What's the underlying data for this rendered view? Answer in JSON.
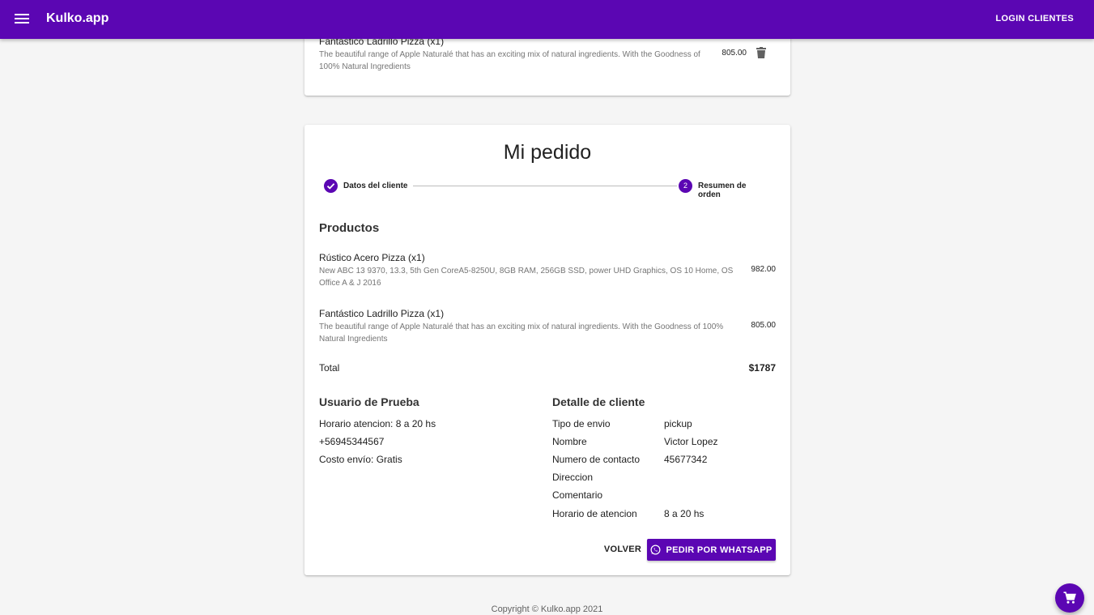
{
  "appbar": {
    "brand": "Kulko.app",
    "login_label": "LOGIN CLIENTES"
  },
  "cart_preview": {
    "item": {
      "name": "Fantástico Ladrillo Pizza (x1)",
      "description": "The beautiful range of Apple Naturalé that has an exciting mix of natural ingredients. With the Goodness of 100% Natural Ingredients",
      "price": "805.00"
    }
  },
  "order": {
    "title": "Mi pedido",
    "steps": [
      {
        "label": "Datos del cliente",
        "state": "done"
      },
      {
        "number": "2",
        "label": "Resumen de orden",
        "state": "active"
      }
    ],
    "products_heading": "Productos",
    "products": [
      {
        "name": "Rústico Acero Pizza (x1)",
        "description": "New ABC 13 9370, 13.3, 5th Gen CoreA5-8250U, 8GB RAM, 256GB SSD, power UHD Graphics, OS 10 Home, OS Office A & J 2016",
        "price": "982.00"
      },
      {
        "name": "Fantástico Ladrillo Pizza (x1)",
        "description": "The beautiful range of Apple Naturalé that has an exciting mix of natural ingredients. With the Goodness of 100% Natural Ingredients",
        "price": "805.00"
      }
    ],
    "total_label": "Total",
    "total_value": "$1787",
    "store": {
      "heading": "Usuario de Prueba",
      "lines": [
        "Horario atencion: 8 a 20 hs",
        "+56945344567",
        "Costo envío: Gratis"
      ]
    },
    "client": {
      "heading": "Detalle de cliente",
      "rows": [
        {
          "label": "Tipo de envio",
          "value": "pickup"
        },
        {
          "label": "Nombre",
          "value": "Victor Lopez"
        },
        {
          "label": "Numero de contacto",
          "value": "45677342"
        },
        {
          "label": "Direccion",
          "value": ""
        },
        {
          "label": "Comentario",
          "value": ""
        },
        {
          "label": "Horario de atencion",
          "value": "8 a 20 hs"
        }
      ]
    },
    "back_label": "VOLVER",
    "whatsapp_label": "PEDIR POR WHATSAPP"
  },
  "footer": {
    "copyright": "Copyright © Kulko.app 2021"
  },
  "colors": {
    "primary": "#5b06b3"
  },
  "icons": {
    "menu": "menu-icon",
    "trash": "trash-icon",
    "check": "check-icon",
    "whatsapp": "whatsapp-icon",
    "cart": "cart-icon"
  }
}
